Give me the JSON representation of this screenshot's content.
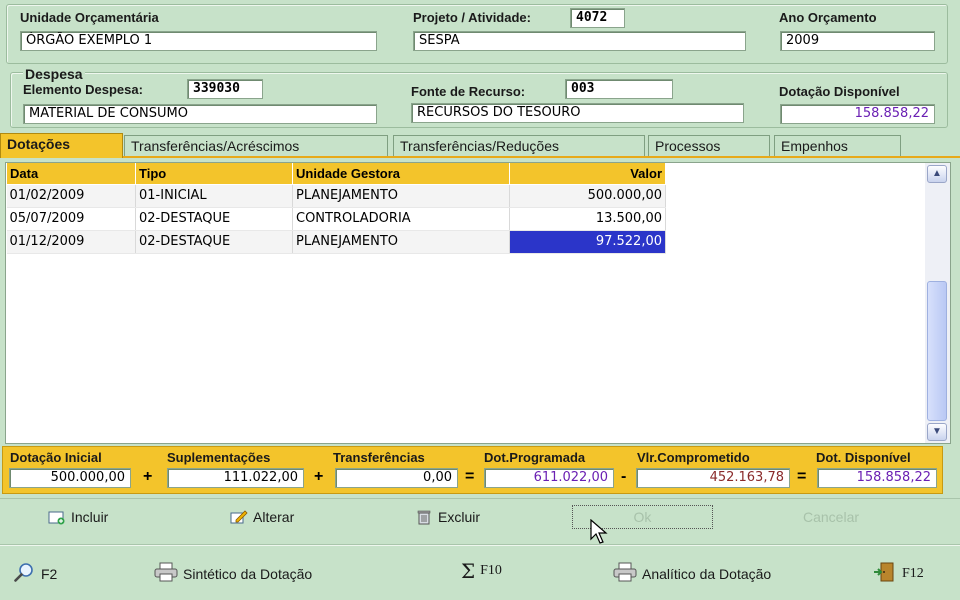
{
  "header": {
    "unidade_label": "Unidade Orçamentária",
    "unidade_value": "ÓRGÃO EXEMPLO 1",
    "projeto_label": "Projeto / Atividade:",
    "projeto_code": "4072",
    "projeto_value": "SESPA",
    "ano_label": "Ano Orçamento",
    "ano_value": "2009"
  },
  "despesa": {
    "title": "Despesa",
    "elemento_label": "Elemento Despesa:",
    "elemento_code": "339030",
    "elemento_value": "MATERIAL DE CONSUMO",
    "fonte_label": "Fonte de Recurso:",
    "fonte_code": "003",
    "fonte_value": "RECURSOS DO TESOURO",
    "dotacao_label": "Dotação Disponível",
    "dotacao_value": "158.858,22"
  },
  "tabs": [
    {
      "label": "Dotações"
    },
    {
      "label": "Transferências/Acréscimos"
    },
    {
      "label": "Transferências/Reduções"
    },
    {
      "label": "Processos"
    },
    {
      "label": "Empenhos"
    }
  ],
  "grid": {
    "columns": [
      "Data",
      "Tipo",
      "Unidade Gestora",
      "Valor"
    ],
    "rows": [
      {
        "data": "01/02/2009",
        "tipo": "01-INICIAL",
        "unidade": "PLANEJAMENTO",
        "valor": "500.000,00"
      },
      {
        "data": "05/07/2009",
        "tipo": "02-DESTAQUE",
        "unidade": "CONTROLADORIA",
        "valor": "13.500,00"
      },
      {
        "data": "01/12/2009",
        "tipo": "02-DESTAQUE",
        "unidade": "PLANEJAMENTO",
        "valor": "97.522,00"
      }
    ]
  },
  "totals": {
    "inicial_label": "Dotação Inicial",
    "inicial_value": "500.000,00",
    "suplementacoes_label": "Suplementações",
    "suplementacoes_value": "111.022,00",
    "transferencias_label": "Transferências",
    "transferencias_value": "0,00",
    "programada_label": "Dot.Programada",
    "programada_value": "611.022,00",
    "comprometido_label": "Vlr.Comprometido",
    "comprometido_value": "452.163,78",
    "disponivel_label": "Dot. Disponível",
    "disponivel_value": "158.858,22",
    "op_plus": "+",
    "op_eq": "=",
    "op_minus": "-"
  },
  "actions": {
    "incluir": "Incluir",
    "alterar": "Alterar",
    "excluir": "Excluir",
    "ok": "Ok",
    "cancelar": "Cancelar"
  },
  "footer": {
    "f2": "F2",
    "sintetico": "Sintético da Dotação",
    "f10": "F10",
    "analitico": "Analítico da Dotação",
    "f12": "F12"
  },
  "colors": {
    "background": "#c7e2c9",
    "accent": "#f3c42b",
    "selection": "#2b35c9"
  }
}
